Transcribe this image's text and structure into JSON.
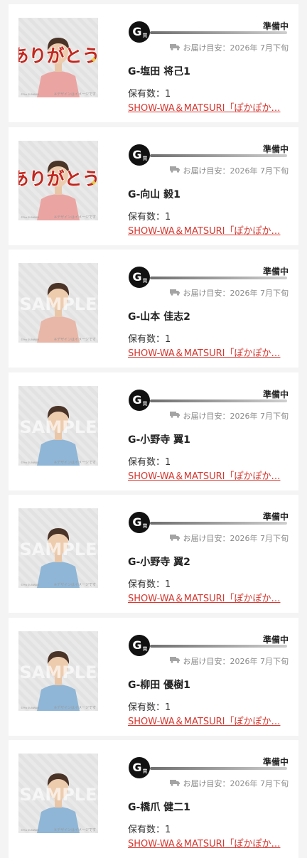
{
  "items": [
    {
      "image": "ありがとう",
      "image_type": "thanks",
      "design_note": "※デザインはイメージです",
      "credit": "©Pro SUNWAN",
      "icon": "G賞",
      "status": "準備中",
      "delivery": "お届け目安：2026年 7月下旬",
      "name": "G-塩田 将己1",
      "owned": "保有数：1",
      "series": "SHOW-WA＆MATSURI「ぽかぽか…"
    },
    {
      "image": "ありがとう",
      "image_type": "thanks",
      "design_note": "※デザインはイメージです",
      "credit": "©Pro SUNWAN",
      "icon": "G賞",
      "status": "準備中",
      "delivery": "お届け目安：2026年 7月下旬",
      "name": "G-向山 毅1",
      "owned": "保有数：1",
      "series": "SHOW-WA＆MATSURI「ぽかぽか…"
    },
    {
      "image": "SAMPLE",
      "image_type": "sample",
      "design_note": "※デザインはイメージです",
      "credit": "©Pro SUNWAN",
      "icon": "G賞",
      "status": "準備中",
      "delivery": "お届け目安：2026年 7月下旬",
      "name": "G-山本 佳志2",
      "owned": "保有数：1",
      "series": "SHOW-WA＆MATSURI「ぽかぽか…"
    },
    {
      "image": "SAMPLE",
      "image_type": "sample",
      "design_note": "※デザインはイメージです",
      "credit": "©Pro SUNWAN",
      "icon": "G賞",
      "status": "準備中",
      "delivery": "お届け目安：2026年 7月下旬",
      "name": "G-小野寺 翼1",
      "owned": "保有数：1",
      "series": "SHOW-WA＆MATSURI「ぽかぽか…"
    },
    {
      "image": "SAMPLE",
      "image_type": "sample",
      "design_note": "※デザインはイメージです",
      "credit": "©Pro SUNWAN",
      "icon": "G賞",
      "status": "準備中",
      "delivery": "お届け目安：2026年 7月下旬",
      "name": "G-小野寺 翼2",
      "owned": "保有数：1",
      "series": "SHOW-WA＆MATSURI「ぽかぽか…"
    },
    {
      "image": "SAMPLE",
      "image_type": "sample",
      "design_note": "※デザインはイメージです",
      "credit": "©Pro SUNWAN",
      "icon": "G賞",
      "status": "準備中",
      "delivery": "お届け目安：2026年 7月下旬",
      "name": "G-柳田 優樹1",
      "owned": "保有数：1",
      "series": "SHOW-WA＆MATSURI「ぽかぽか…"
    },
    {
      "image": "SAMPLE",
      "image_type": "sample",
      "design_note": "※デザインはイメージです",
      "credit": "©Pro SUNWAN",
      "icon": "G賞",
      "status": "準備中",
      "delivery": "お届け目安：2026年 7月下旬",
      "name": "G-橋爪 健二1",
      "owned": "保有数：1",
      "series": "SHOW-WA＆MATSURI「ぽかぽか…"
    }
  ],
  "colors": {
    "link": "#d6372f",
    "thanks_text": "#c0271f",
    "page_bg": "#f4f4f4",
    "card_bg": "#ffffff"
  }
}
